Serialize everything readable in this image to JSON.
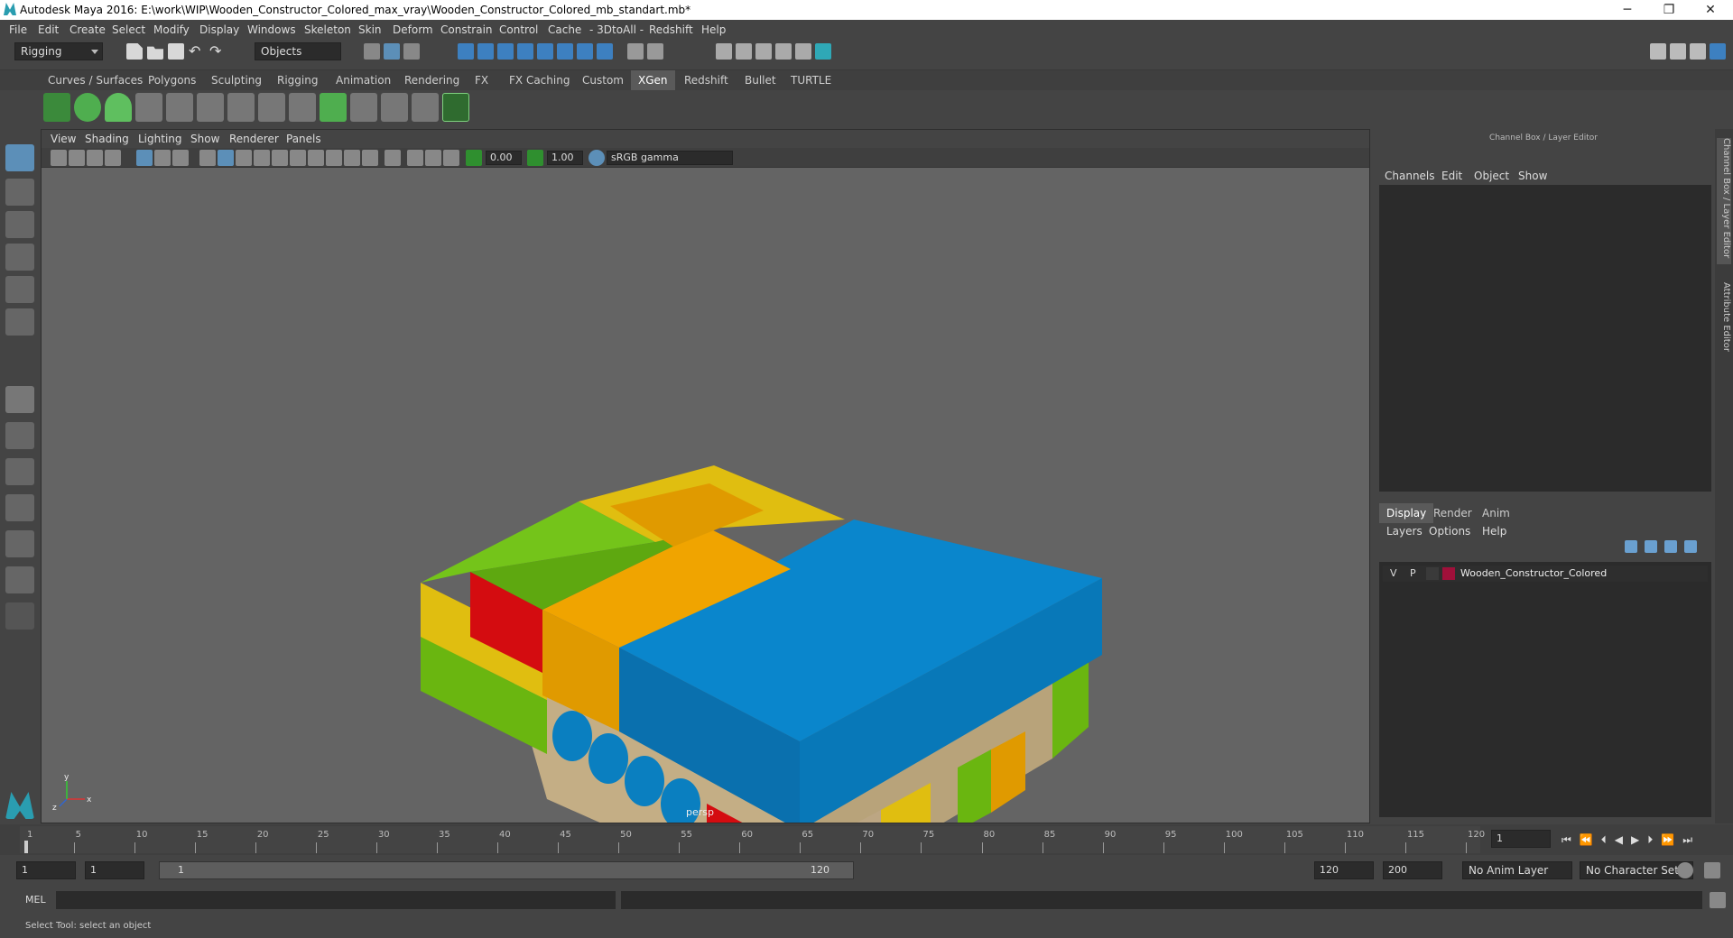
{
  "window": {
    "title": "Autodesk Maya 2016: E:\\work\\WIP\\Wooden_Constructor_Colored_max_vray\\Wooden_Constructor_Colored_mb_standart.mb*",
    "minimize": "─",
    "restore": "❐",
    "close": "✕"
  },
  "menubar": [
    "File",
    "Edit",
    "Create",
    "Select",
    "Modify",
    "Display",
    "Windows",
    "Skeleton",
    "Skin",
    "Deform",
    "Constrain",
    "Control",
    "Cache",
    "- 3DtoAll -",
    "Redshift",
    "Help"
  ],
  "statusline": {
    "mode": "Rigging",
    "selection_mode": "Objects"
  },
  "shelf_tabs": [
    "Curves / Surfaces",
    "Polygons",
    "Sculpting",
    "Rigging",
    "Animation",
    "Rendering",
    "FX",
    "FX Caching",
    "Custom",
    "XGen",
    "Redshift",
    "Bullet",
    "TURTLE"
  ],
  "active_shelf_tab": "XGen",
  "viewport": {
    "menu": [
      "View",
      "Shading",
      "Lighting",
      "Show",
      "Renderer",
      "Panels"
    ],
    "exposure": "0.00",
    "gamma": "1.00",
    "color_space": "sRGB gamma",
    "camera": "persp",
    "axis_x": "x",
    "axis_y": "y",
    "axis_z": "z",
    "colors": {
      "background": "#646464",
      "yellow": "#e0be10",
      "orange": "#e09a00",
      "green": "#6ab610",
      "blue": "#0a7fc0",
      "red": "#d40c10",
      "wood": "#c9b48c"
    }
  },
  "channel_box": {
    "header": "Channel Box / Layer Editor",
    "menu": [
      "Channels",
      "Edit",
      "Object",
      "Show"
    ]
  },
  "layer_editor": {
    "tabs": [
      "Display",
      "Render",
      "Anim"
    ],
    "active_tab": "Display",
    "menu": [
      "Layers",
      "Options",
      "Help"
    ],
    "layers": [
      {
        "v": "V",
        "p": "P",
        "name": "Wooden_Constructor_Colored",
        "color": "#a0103a"
      }
    ]
  },
  "side_tabs": [
    "Channel Box / Layer Editor",
    "Attribute Editor"
  ],
  "timeline": {
    "ticks": [
      "1",
      "5",
      "10",
      "15",
      "20",
      "25",
      "30",
      "35",
      "40",
      "45",
      "50",
      "55",
      "60",
      "65",
      "70",
      "75",
      "80",
      "85",
      "90",
      "95",
      "100",
      "105",
      "110",
      "115",
      "120"
    ],
    "current_frame": "1"
  },
  "range": {
    "start": "1",
    "anim_start": "1",
    "slider_start": "1",
    "slider_end": "120",
    "anim_end": "120",
    "end": "200",
    "anim_layer": "No Anim Layer",
    "character_set": "No Character Set"
  },
  "command_line": {
    "label": "MEL"
  },
  "help_line": "Select Tool: select an object"
}
